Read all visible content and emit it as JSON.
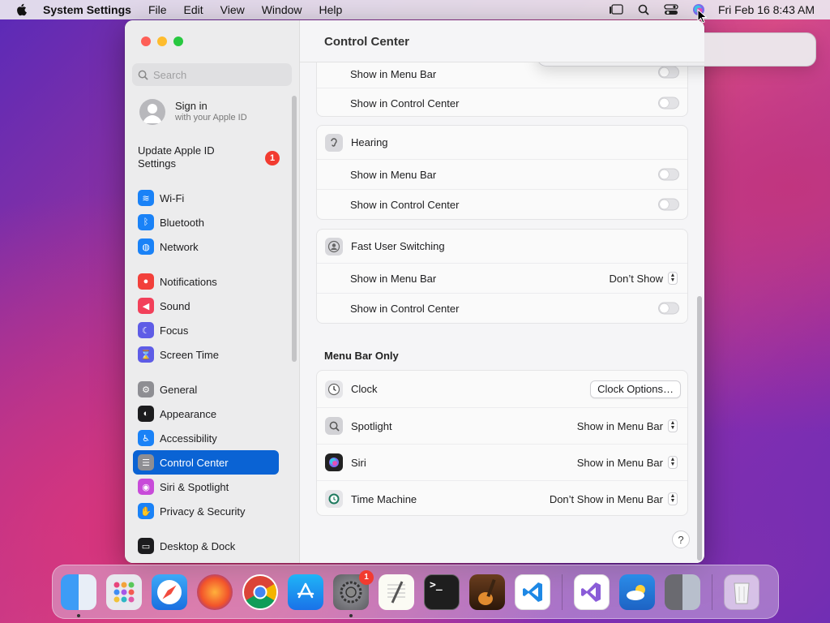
{
  "menubar": {
    "app_name": "System Settings",
    "menus": [
      "File",
      "Edit",
      "View",
      "Window",
      "Help"
    ],
    "clock": "Fri Feb 16  8:43 AM"
  },
  "sidebar": {
    "search_placeholder": "Search",
    "signin_title": "Sign in",
    "signin_subtitle": "with your Apple ID",
    "update_label": "Update Apple ID Settings",
    "update_badge": "1",
    "items": [
      {
        "label": "Wi-Fi",
        "icon": "wifi-icon",
        "color": "#1a82f7"
      },
      {
        "label": "Bluetooth",
        "icon": "bluetooth-icon",
        "color": "#1a82f7"
      },
      {
        "label": "Network",
        "icon": "globe-icon",
        "color": "#1a82f7"
      },
      {
        "label": "Notifications",
        "icon": "bell-icon",
        "color": "#f2403b"
      },
      {
        "label": "Sound",
        "icon": "speaker-icon",
        "color": "#f2405a"
      },
      {
        "label": "Focus",
        "icon": "moon-icon",
        "color": "#5e5ce6"
      },
      {
        "label": "Screen Time",
        "icon": "hourglass-icon",
        "color": "#5e5ce6"
      },
      {
        "label": "General",
        "icon": "gear-icon",
        "color": "#8e8e93"
      },
      {
        "label": "Appearance",
        "icon": "appearance-icon",
        "color": "#1c1c1e"
      },
      {
        "label": "Accessibility",
        "icon": "accessibility-icon",
        "color": "#1a82f7"
      },
      {
        "label": "Control Center",
        "icon": "control-center-icon",
        "color": "#8e8e93"
      },
      {
        "label": "Siri & Spotlight",
        "icon": "siri-icon",
        "color": "#c84bd9"
      },
      {
        "label": "Privacy & Security",
        "icon": "hand-icon",
        "color": "#1a82f7"
      },
      {
        "label": "Desktop & Dock",
        "icon": "dock-icon",
        "color": "#1c1c1e"
      }
    ]
  },
  "content": {
    "title": "Control Center",
    "top_partial": {
      "row1": "Show in Menu Bar",
      "row2": "Show in Control Center"
    },
    "hearing": {
      "title": "Hearing",
      "row1": "Show in Menu Bar",
      "row2": "Show in Control Center"
    },
    "fast_user": {
      "title": "Fast User Switching",
      "row1": "Show in Menu Bar",
      "row1_value": "Don’t Show",
      "row2": "Show in Control Center"
    },
    "menu_bar_only": {
      "heading": "Menu Bar Only",
      "clock": "Clock",
      "clock_button": "Clock Options…",
      "spotlight": "Spotlight",
      "spotlight_value": "Show in Menu Bar",
      "siri": "Siri",
      "siri_value": "Show in Menu Bar",
      "time_machine": "Time Machine",
      "time_machine_value": "Don’t Show in Menu Bar"
    },
    "help": "?"
  },
  "dock": {
    "system_settings_badge": "1"
  }
}
